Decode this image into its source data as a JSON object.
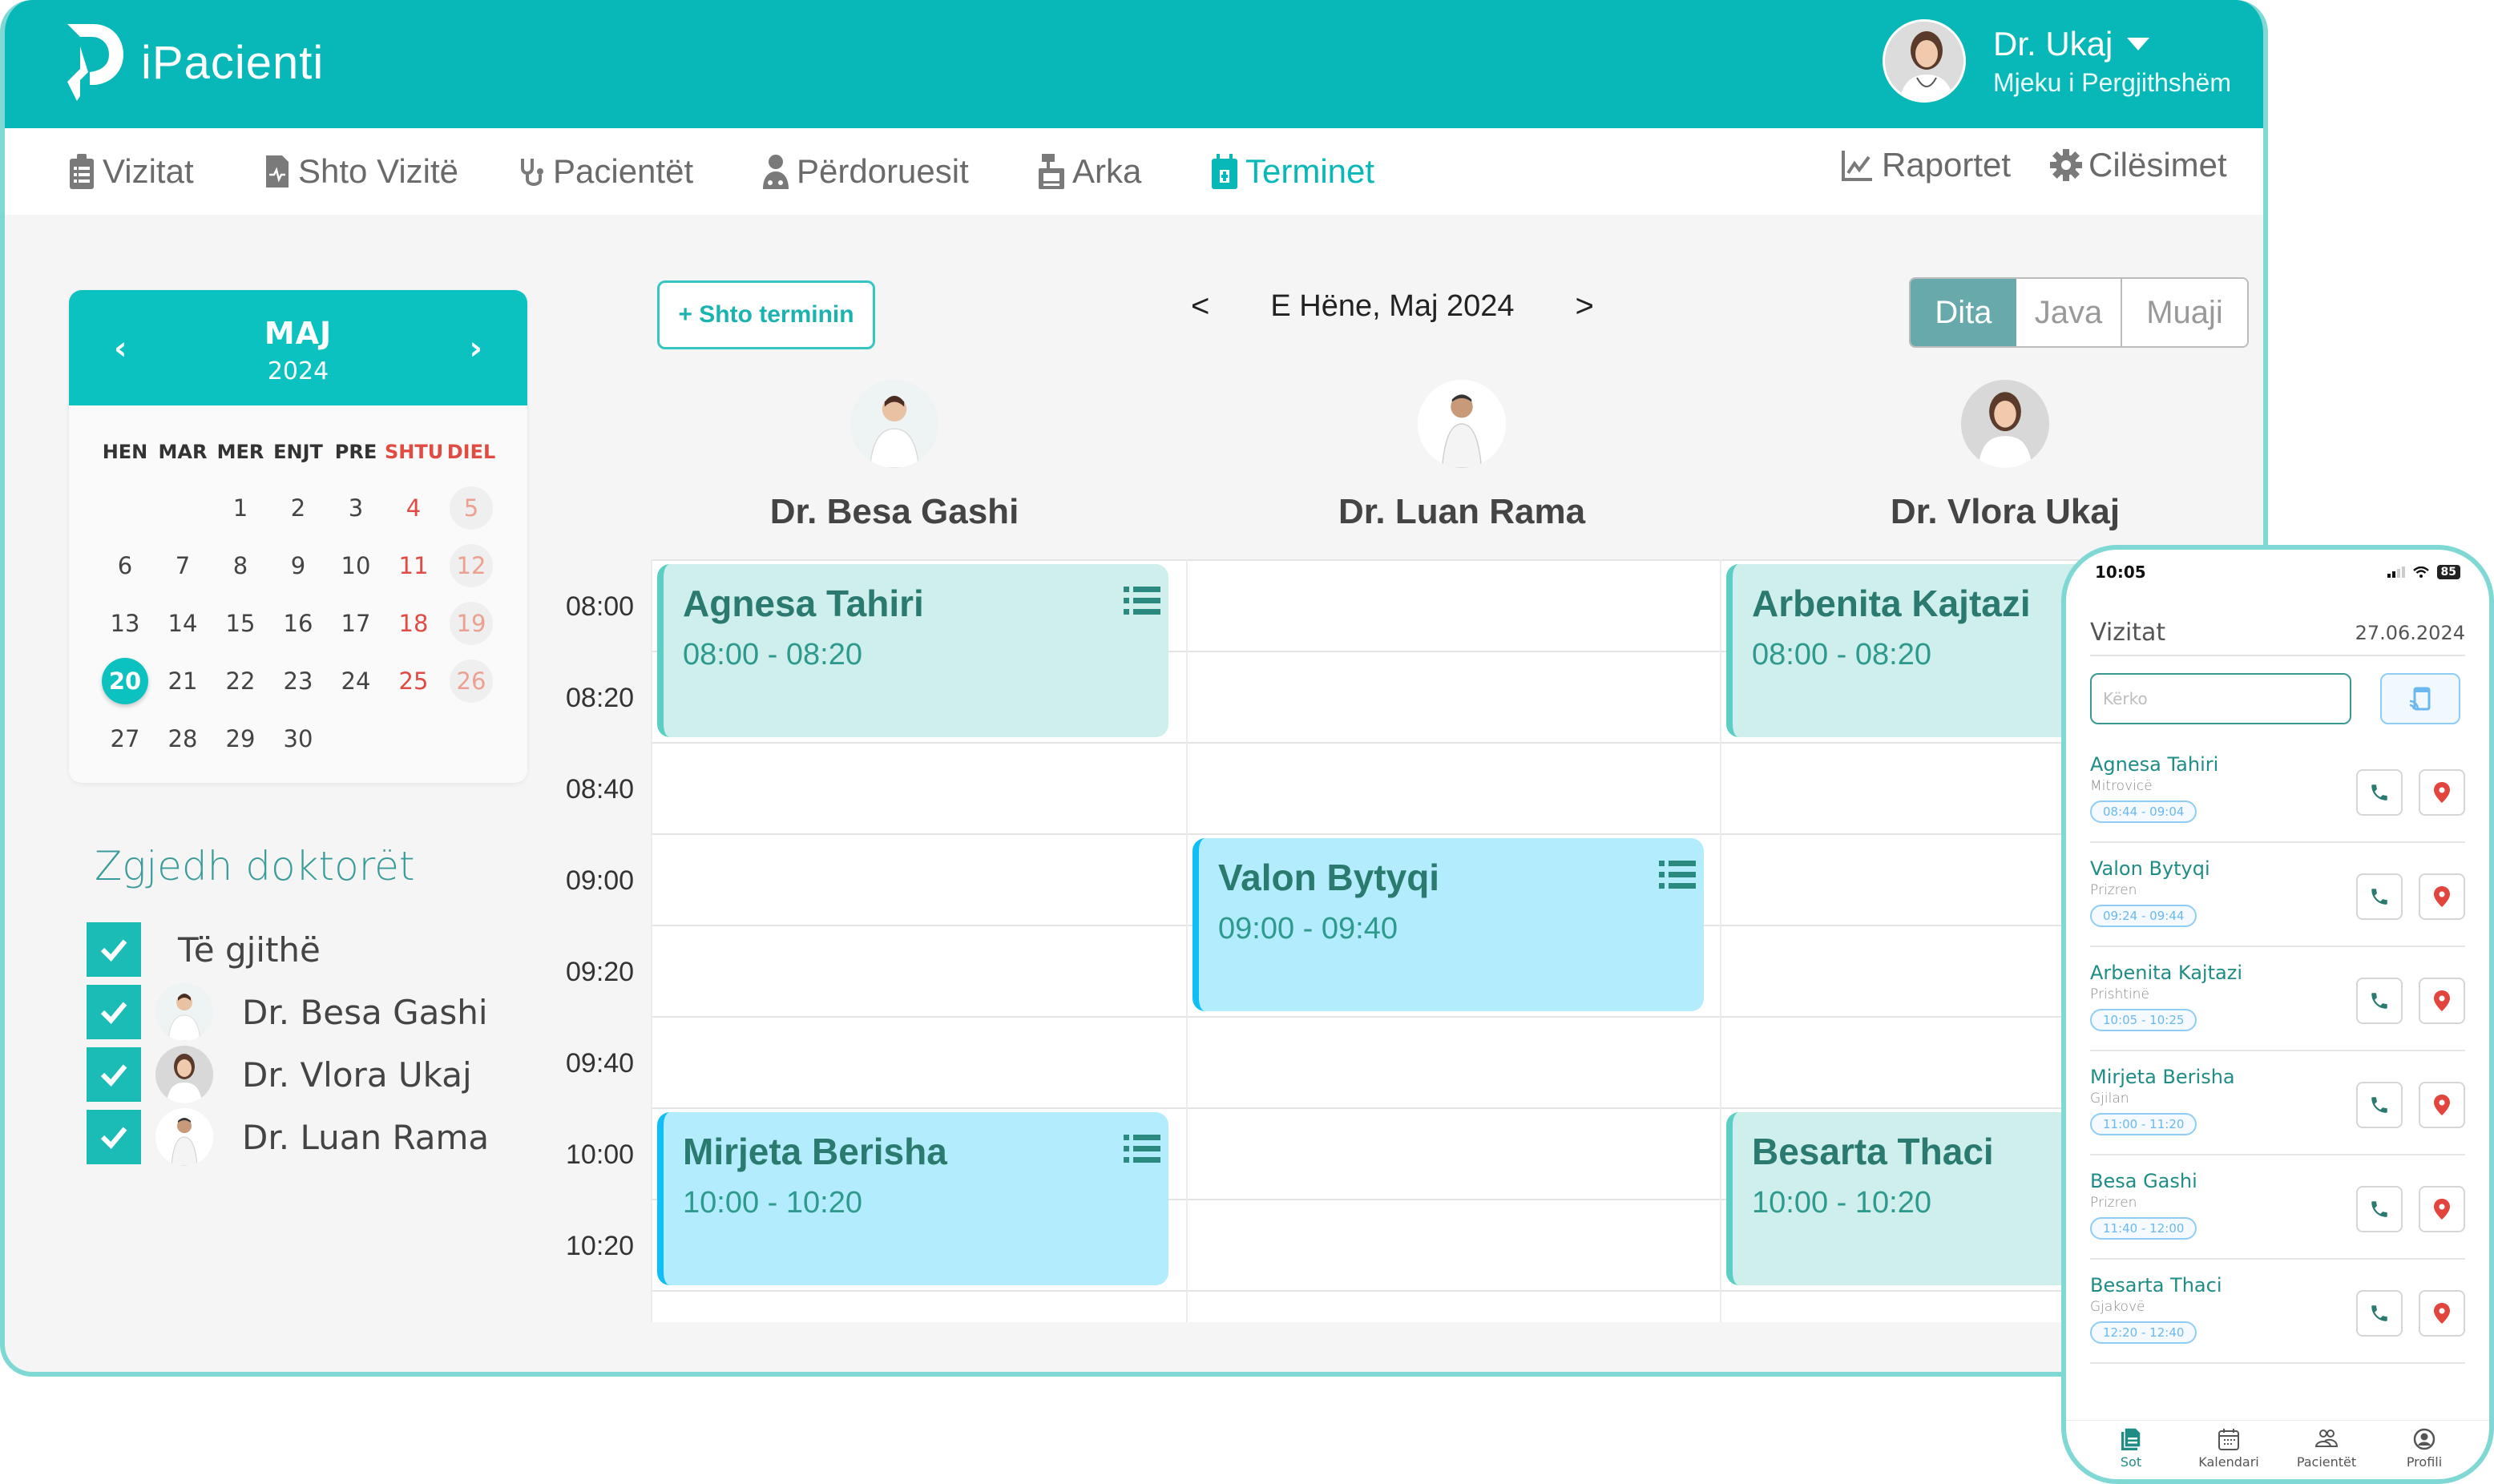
{
  "app": {
    "brand": "iPacienti",
    "brand_color": "#08b8b8",
    "user": {
      "name": "Dr. Ukaj",
      "role": "Mjeku i Pergjithshëm"
    }
  },
  "nav": {
    "items": [
      {
        "label": "Vizitat",
        "icon": "clipboard-icon",
        "active": false
      },
      {
        "label": "Shto Vizitë",
        "icon": "add-file-icon",
        "active": false
      },
      {
        "label": "Pacientët",
        "icon": "stethoscope-icon",
        "active": false
      },
      {
        "label": "Përdoruesit",
        "icon": "user-md-icon",
        "active": false
      },
      {
        "label": "Arka",
        "icon": "cash-register-icon",
        "active": false
      },
      {
        "label": "Terminet",
        "icon": "calendar-plus-icon",
        "active": true
      }
    ],
    "right": [
      {
        "label": "Raportet",
        "icon": "chart-line-icon"
      },
      {
        "label": "Cilësimet",
        "icon": "gear-icon"
      }
    ]
  },
  "mini_calendar": {
    "month": "MAJ",
    "year": "2024",
    "weekdays": [
      "HEN",
      "MAR",
      "MER",
      "ENJT",
      "PRE",
      "SHTU",
      "DIEL"
    ],
    "weeks": [
      [
        "",
        "",
        "1",
        "2",
        "3",
        "4",
        "5"
      ],
      [
        "6",
        "7",
        "8",
        "9",
        "10",
        "11",
        "12"
      ],
      [
        "13",
        "14",
        "15",
        "16",
        "17",
        "18",
        "19"
      ],
      [
        "20",
        "21",
        "22",
        "23",
        "24",
        "25",
        "26"
      ],
      [
        "27",
        "28",
        "29",
        "30",
        "",
        "",
        ""
      ]
    ],
    "selected_day": "20",
    "weekend_color": "#e04b43"
  },
  "doctor_filter": {
    "title": "Zgjedh doktorët",
    "all_label": "Të gjithë",
    "all_checked": true,
    "doctors": [
      {
        "name": "Dr. Besa Gashi",
        "checked": true
      },
      {
        "name": "Dr. Vlora Ukaj",
        "checked": true
      },
      {
        "name": "Dr. Luan Rama",
        "checked": true
      }
    ]
  },
  "scheduler": {
    "add_button": "+ Shto terminin",
    "prev": "<",
    "next": ">",
    "current_date": "E Hëne, Maj 2024",
    "views": [
      "Dita",
      "Java",
      "Muaji"
    ],
    "active_view": "Dita",
    "columns": [
      "Dr. Besa Gashi",
      "Dr. Luan Rama",
      "Dr. Vlora Ukaj"
    ],
    "time_slots": [
      "08:00",
      "08:20",
      "08:40",
      "09:00",
      "09:20",
      "09:40",
      "10:00",
      "10:20"
    ],
    "events": [
      {
        "patient": "Agnesa Tahiri",
        "time": "08:00 - 08:20",
        "column": 0,
        "style": "mint",
        "menu": true
      },
      {
        "patient": "Valon Bytyqi",
        "time": "09:00 - 09:40",
        "column": 1,
        "style": "sky",
        "menu": true
      },
      {
        "patient": "Arbenita Kajtazi",
        "time": "08:00 - 08:20",
        "column": 2,
        "style": "mint",
        "menu": false
      },
      {
        "patient": "Mirjeta Berisha",
        "time": "10:00 - 10:20",
        "column": 0,
        "style": "sky",
        "menu": true
      },
      {
        "patient": "Besarta Thaci",
        "time": "10:00 - 10:20",
        "column": 2,
        "style": "mint",
        "menu": false
      }
    ]
  },
  "mobile": {
    "status_time": "10:05",
    "battery": "85",
    "title": "Vizitat",
    "date": "27.06.2024",
    "search_placeholder": "Kërko",
    "visits": [
      {
        "name": "Agnesa Tahiri",
        "city": "Mitrovicë",
        "time": "08:44 - 09:04"
      },
      {
        "name": "Valon Bytyqi",
        "city": "Prizren",
        "time": "09:24 - 09:44"
      },
      {
        "name": " Arbenita  Kajtazi",
        "city": "Prishtinë",
        "time": "10:05 - 10:25"
      },
      {
        "name": "Mirjeta Berisha",
        "city": "Gjilan",
        "time": "11:00 - 11:20"
      },
      {
        "name": "Besa Gashi",
        "city": "Prizren",
        "time": "11:40 - 12:00"
      },
      {
        "name": "Besarta Thaci",
        "city": "Gjakovë",
        "time": "12:20 - 12:40"
      }
    ],
    "tabs": [
      {
        "label": "Sot",
        "icon": "document-icon",
        "active": true
      },
      {
        "label": "Kalendari",
        "icon": "calendar-icon",
        "active": false
      },
      {
        "label": "Pacientët",
        "icon": "users-icon",
        "active": false
      },
      {
        "label": "Profili",
        "icon": "profile-icon",
        "active": false
      }
    ]
  }
}
